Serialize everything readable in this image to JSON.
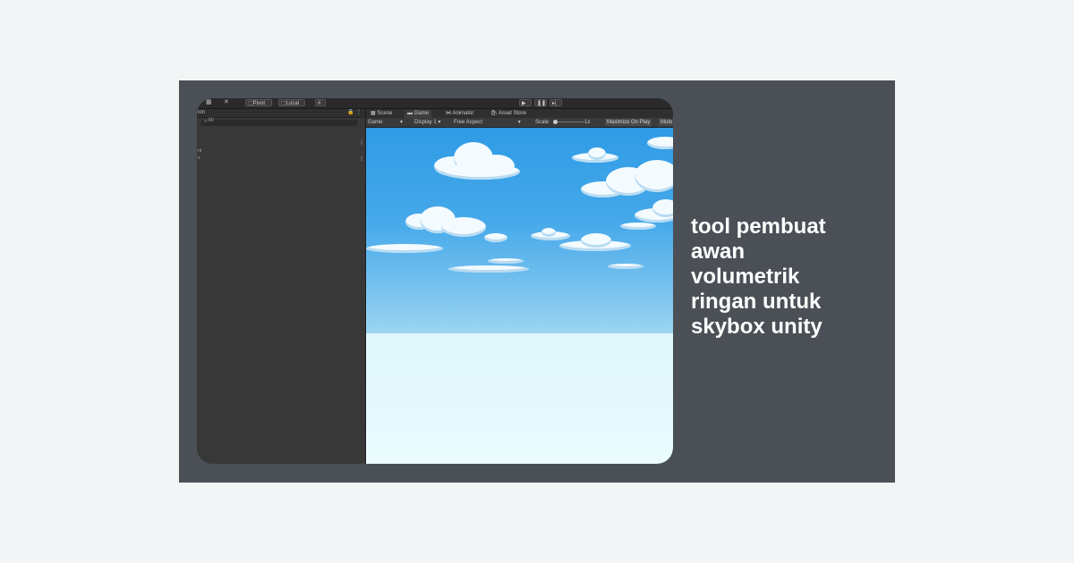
{
  "caption_lines": [
    "tool pembuat",
    "awan",
    "volumetrik",
    "ringan untuk",
    "skybox unity"
  ],
  "editor": {
    "toolbar": {
      "pivot_label": "Pivot",
      "local_label": "Local"
    },
    "hierarchy": {
      "header_label": "ion",
      "search_placeholder": "All",
      "rows": [
        "nt",
        "s"
      ]
    },
    "tabs": [
      {
        "label": "Scene"
      },
      {
        "label": "Game"
      },
      {
        "label": "Animator"
      },
      {
        "label": "Asset Store"
      }
    ],
    "game_bar": {
      "view_select": "Game",
      "display_select": "Display 1",
      "aspect_select": "Free Aspect",
      "scale_label": "Scale",
      "scale_value": "1x",
      "maximize_label": "Maximize On Play",
      "mute_label": "Mute"
    }
  },
  "colors": {
    "card_bg": "#4b5057",
    "page_bg": "#f3f4f6",
    "sky_top": "#2f9be6",
    "ground": "#eafcff"
  }
}
